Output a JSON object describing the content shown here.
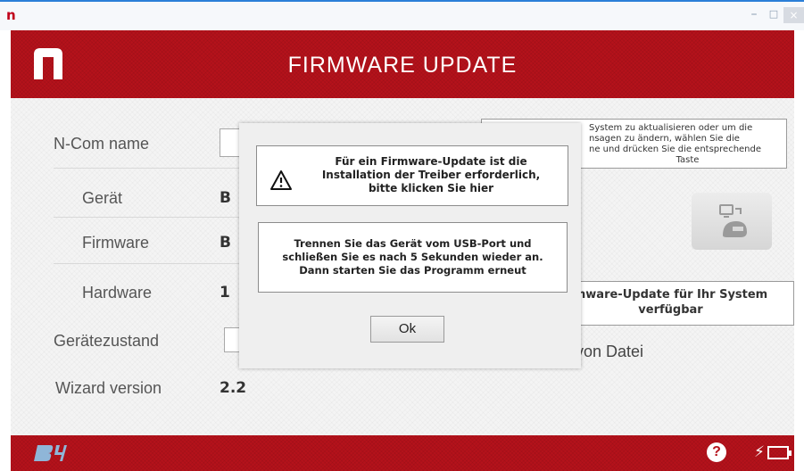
{
  "window": {
    "app_glyph": "n",
    "minimize": "–",
    "maximize": "□",
    "close": "×"
  },
  "header": {
    "title": "FIRMWARE UPDATE"
  },
  "form": {
    "ncom_name_label": "N-Com name",
    "device_label": "Gerät",
    "device_value": "B",
    "firmware_label": "Firmware",
    "firmware_value": "B",
    "hardware_label": "Hardware",
    "hardware_value": "1",
    "device_state_label": "Gerätezustand",
    "wizard_version_label": "Wizard version",
    "wizard_version_value": "2.2"
  },
  "right_panel": {
    "info_line1": "System zu aktualisieren oder um die",
    "info_line2": "nsagen zu ändern, wählen Sie die",
    "info_line3": "ne und drücken Sie die entsprechende",
    "info_line4": "Taste",
    "fw_available_line1": "mware-Update für Ihr System",
    "fw_available_line2": "verfügbar",
    "from_file": "von Datei"
  },
  "modal": {
    "driver_line1": "Für ein Firmware-Update ist die",
    "driver_line2": "Installation der Treiber erforderlich,",
    "driver_line3": "bitte klicken Sie hier",
    "usb_line1": "Trennen Sie das Gerät vom USB-Port und",
    "usb_line2": "schließen Sie es nach 5 Sekunden wieder an.",
    "usb_line3": "Dann starten Sie das Programm erneut",
    "ok_label": "Ok"
  },
  "footer": {
    "help": "?",
    "bolt": "⚡"
  },
  "colors": {
    "brand_red": "#b5121b",
    "accent_blue": "#2b7fd8"
  }
}
